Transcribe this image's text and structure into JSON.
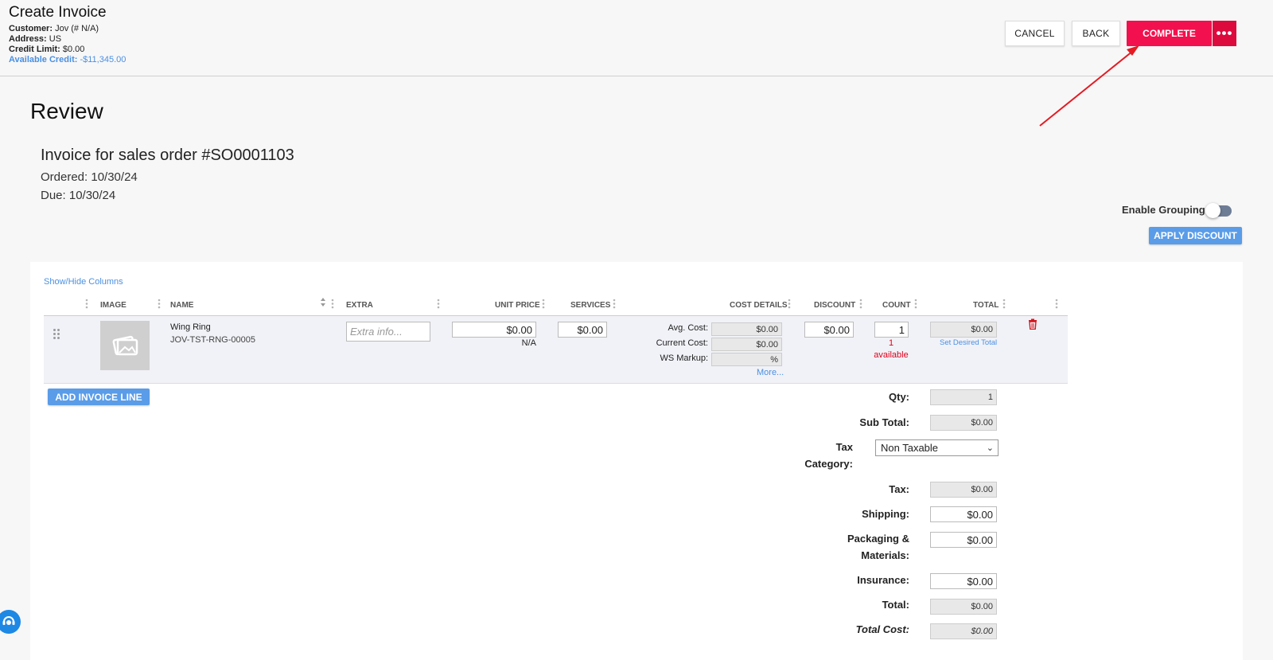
{
  "header": {
    "title": "Create Invoice",
    "customer_label": "Customer:",
    "customer_value": " Jov (# N/A)",
    "address_label": "Address:",
    "address_value": " US",
    "credit_limit_label": "Credit Limit:",
    "credit_limit_value": " $0.00",
    "available_credit_label": "Available Credit:",
    "available_credit_value": " -$11,345.00",
    "buttons": {
      "cancel": "CANCEL",
      "back": "BACK",
      "complete": "COMPLETE",
      "more": "•••"
    }
  },
  "review": {
    "heading": "Review",
    "invoice_title": "Invoice for sales order #SO0001103",
    "ordered": "Ordered: 10/30/24",
    "due": "Due: 10/30/24",
    "enable_grouping_label": "Enable Grouping",
    "enable_grouping_on": false,
    "apply_discount": "APPLY DISCOUNT"
  },
  "table": {
    "show_hide_columns": "Show/Hide Columns",
    "columns": {
      "image": "IMAGE",
      "name": "NAME",
      "extra": "EXTRA",
      "unit_price": "UNIT PRICE",
      "services": "SERVICES",
      "cost_details": "COST DETAILS",
      "discount": "DISCOUNT",
      "count": "COUNT",
      "total": "TOTAL"
    },
    "rows": [
      {
        "name": "Wing Ring",
        "sku": "JOV-TST-RNG-00005",
        "extra_placeholder": "Extra info...",
        "unit_price": "$0.00",
        "unit_price_note": "N/A",
        "services": "$0.00",
        "avg_cost_label": "Avg. Cost:",
        "avg_cost": "$0.00",
        "current_cost_label": "Current Cost:",
        "current_cost": "$0.00",
        "ws_markup_label": "WS Markup:",
        "ws_markup": "%",
        "more": "More...",
        "discount": "$0.00",
        "count": "1",
        "available_count": "1",
        "available_label": "available",
        "total": "$0.00",
        "set_desired_total": "Set Desired Total"
      }
    ],
    "add_invoice_line": "ADD INVOICE LINE"
  },
  "summary": {
    "qty_label": "Qty:",
    "qty": "1",
    "subtotal_label": "Sub Total:",
    "subtotal": "$0.00",
    "tax_category_label_1": "Tax",
    "tax_category_label_2": "Category:",
    "tax_category_value": "Non Taxable",
    "tax_label": "Tax:",
    "tax": "$0.00",
    "shipping_label": "Shipping:",
    "shipping": "$0.00",
    "packaging_label_1": "Packaging &",
    "packaging_label_2": "Materials:",
    "packaging": "$0.00",
    "insurance_label": "Insurance:",
    "insurance": "$0.00",
    "total_label": "Total:",
    "total": "$0.00",
    "total_cost_label": "Total Cost:",
    "total_cost": "$0.00"
  },
  "colors": {
    "complete": "#f2114e",
    "more": "#dd0a3e",
    "link": "#4a90e2",
    "primary_button": "#5a9ce8",
    "annotation_arrow": "#e41b23",
    "available": "#e0001b"
  }
}
